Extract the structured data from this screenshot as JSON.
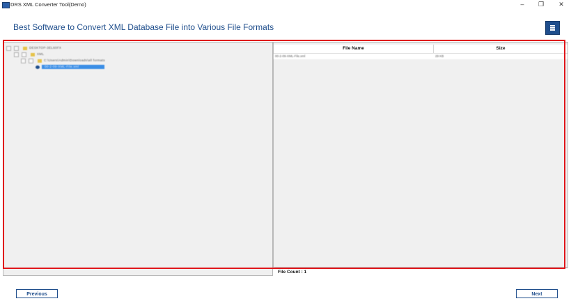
{
  "window": {
    "title": "DRS XML Converter Tool(Demo)",
    "controls": {
      "minimize": "–",
      "restore": "❐",
      "close": "✕"
    }
  },
  "header": {
    "title": "Best Software to Convert XML Database File into Various File Formats",
    "menu_icon": "hamburger-menu-icon"
  },
  "tree": {
    "nodes": [
      {
        "label": "DESKTOP-3EL60FX",
        "level": 0
      },
      {
        "label": "XML",
        "level": 1
      },
      {
        "label": "C:\\Users\\Admin\\Downloads\\all formats",
        "level": 2
      },
      {
        "label": "00-2-09-XML-File.xml",
        "level": 3,
        "selected": true
      }
    ]
  },
  "file_list": {
    "columns": [
      "File Name",
      "Size"
    ],
    "rows": [
      {
        "name": "00-2-09-XML-File.xml",
        "size": "29 KB"
      }
    ]
  },
  "footer": {
    "file_count": "File Count : 1",
    "previous_label": "Previous",
    "next_label": "Next"
  },
  "colors": {
    "accent": "#1f4e8c",
    "highlight_frame": "#e0161b",
    "selected": "#3a8ee6"
  }
}
